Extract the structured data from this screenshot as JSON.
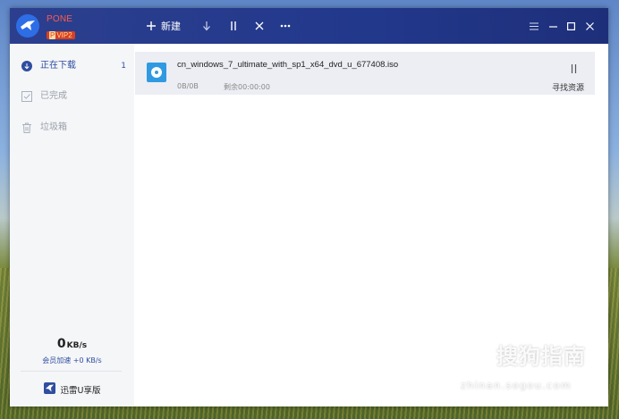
{
  "app": {
    "brand_name": "PONE",
    "vip_badge": "VIP2"
  },
  "toolbar": {
    "new_label": "新建"
  },
  "sidebar": {
    "items": [
      {
        "label": "正在下载",
        "count": "1"
      },
      {
        "label": "已完成",
        "count": ""
      },
      {
        "label": "垃圾箱",
        "count": ""
      }
    ],
    "speed_value": "0",
    "speed_unit": "KB/s",
    "member_accel": "会员加速 +0 KB/s",
    "udisk_label": "迅雷U享版"
  },
  "downloads": [
    {
      "filename": "cn_windows_7_ultimate_with_sp1_x64_dvd_u_677408.iso",
      "progress": "0B/0B",
      "remaining": "剩余00:00:00",
      "action": "寻找资源"
    }
  ],
  "watermark": {
    "text": "搜狗指南",
    "url": "zhinan.sogou.com"
  },
  "colors": {
    "titlebar": "#22388b",
    "accent": "#2f4ea0",
    "brand": "#ff5b4a"
  },
  "icons": [
    "bird-logo-icon",
    "plus-icon",
    "download-arrow-icon",
    "pause-icon",
    "close-x-icon",
    "more-icon",
    "menu-icon",
    "minimize-icon",
    "maximize-icon",
    "window-close-icon",
    "check-icon",
    "trash-icon",
    "disc-file-icon",
    "udisk-icon",
    "sogou-logo-icon"
  ]
}
